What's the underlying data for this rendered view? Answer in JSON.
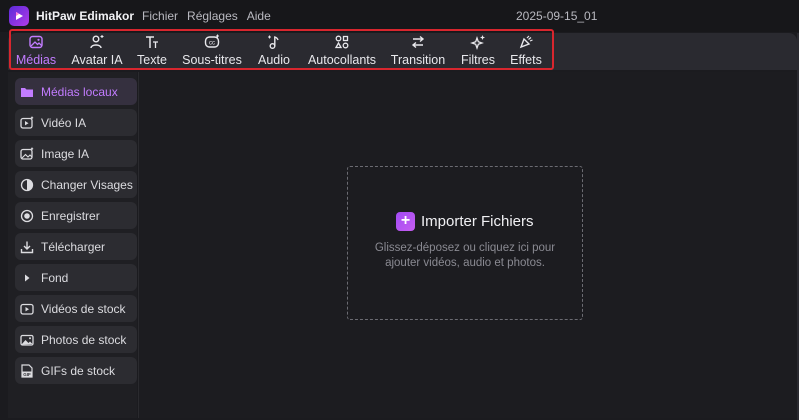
{
  "app": {
    "name": "HitPaw Edimakor",
    "project_name": "2025-09-15_01",
    "brand_color": "#9b40f0"
  },
  "menu": {
    "items": [
      "Fichier",
      "Réglages",
      "Aide"
    ]
  },
  "toolbar": {
    "tabs": [
      {
        "label": "Médias",
        "icon": "media-icon",
        "active": true
      },
      {
        "label": "Avatar IA",
        "icon": "avatar-icon",
        "active": false
      },
      {
        "label": "Texte",
        "icon": "text-icon",
        "active": false
      },
      {
        "label": "Sous-titres",
        "icon": "subtitles-icon",
        "active": false
      },
      {
        "label": "Audio",
        "icon": "audio-icon",
        "active": false
      },
      {
        "label": "Autocollants",
        "icon": "stickers-icon",
        "active": false
      },
      {
        "label": "Transition",
        "icon": "transition-icon",
        "active": false
      },
      {
        "label": "Filtres",
        "icon": "filters-icon",
        "active": false
      },
      {
        "label": "Effets",
        "icon": "effects-icon",
        "active": false
      }
    ],
    "highlight_color": "#d8262e"
  },
  "sidebar": {
    "items": [
      {
        "label": "Médias locaux",
        "icon": "folder-icon",
        "active": true
      },
      {
        "label": "Vidéo IA",
        "icon": "ai-video-icon",
        "active": false
      },
      {
        "label": "Image IA",
        "icon": "ai-image-icon",
        "active": false
      },
      {
        "label": "Changer Visages",
        "icon": "face-swap-icon",
        "active": false
      },
      {
        "label": "Enregistrer",
        "icon": "record-icon",
        "active": false
      },
      {
        "label": "Télécharger",
        "icon": "download-icon",
        "active": false
      },
      {
        "label": "Fond",
        "icon": "play-arrow-icon",
        "active": false
      },
      {
        "label": "Vidéos de stock",
        "icon": "stock-video-icon",
        "active": false
      },
      {
        "label": "Photos de stock",
        "icon": "stock-photo-icon",
        "active": false
      },
      {
        "label": "GIFs de stock",
        "icon": "gif-icon",
        "active": false
      }
    ]
  },
  "main": {
    "import_label": "Importer Fichiers",
    "hint_line1": "Glissez-déposez ou cliquez ici pour",
    "hint_line2": "ajouter vidéos, audio et photos."
  }
}
